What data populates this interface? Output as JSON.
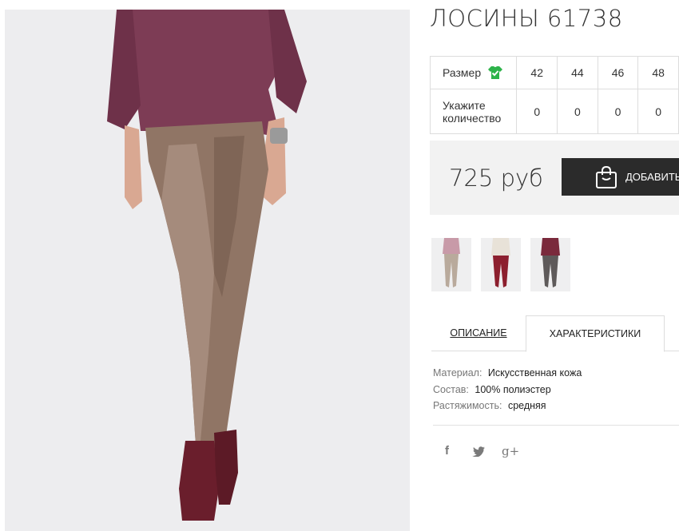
{
  "product": {
    "title": "ЛОСИНЫ 61738",
    "price": "725 руб",
    "add_to_cart": "ДОБАВИТЬ"
  },
  "sizes": {
    "size_label": "Размер",
    "quantity_label_line1": "Укажите",
    "quantity_label_line2": "количество",
    "values": [
      "42",
      "44",
      "46",
      "48"
    ],
    "quantities": [
      "0",
      "0",
      "0",
      "0"
    ]
  },
  "tabs": {
    "description": "ОПИСАНИЕ",
    "characteristics": "ХАРАКТЕРИСТИКИ"
  },
  "characteristics": [
    {
      "key": "Материал:",
      "value": "Искусственная кожа"
    },
    {
      "key": "Состав:",
      "value": "100% полиэстер"
    },
    {
      "key": "Растяжимость:",
      "value": "средняя"
    }
  ],
  "social": {
    "facebook": "f",
    "google_plus": "g+"
  },
  "icons": [
    "shirt-check-icon",
    "shopping-bag-icon",
    "facebook-icon",
    "twitter-icon",
    "google-plus-icon"
  ],
  "colors": {
    "accent_green": "#2db34a",
    "button_dark": "#2b2b2b",
    "price_panel": "#f2f2f2"
  }
}
